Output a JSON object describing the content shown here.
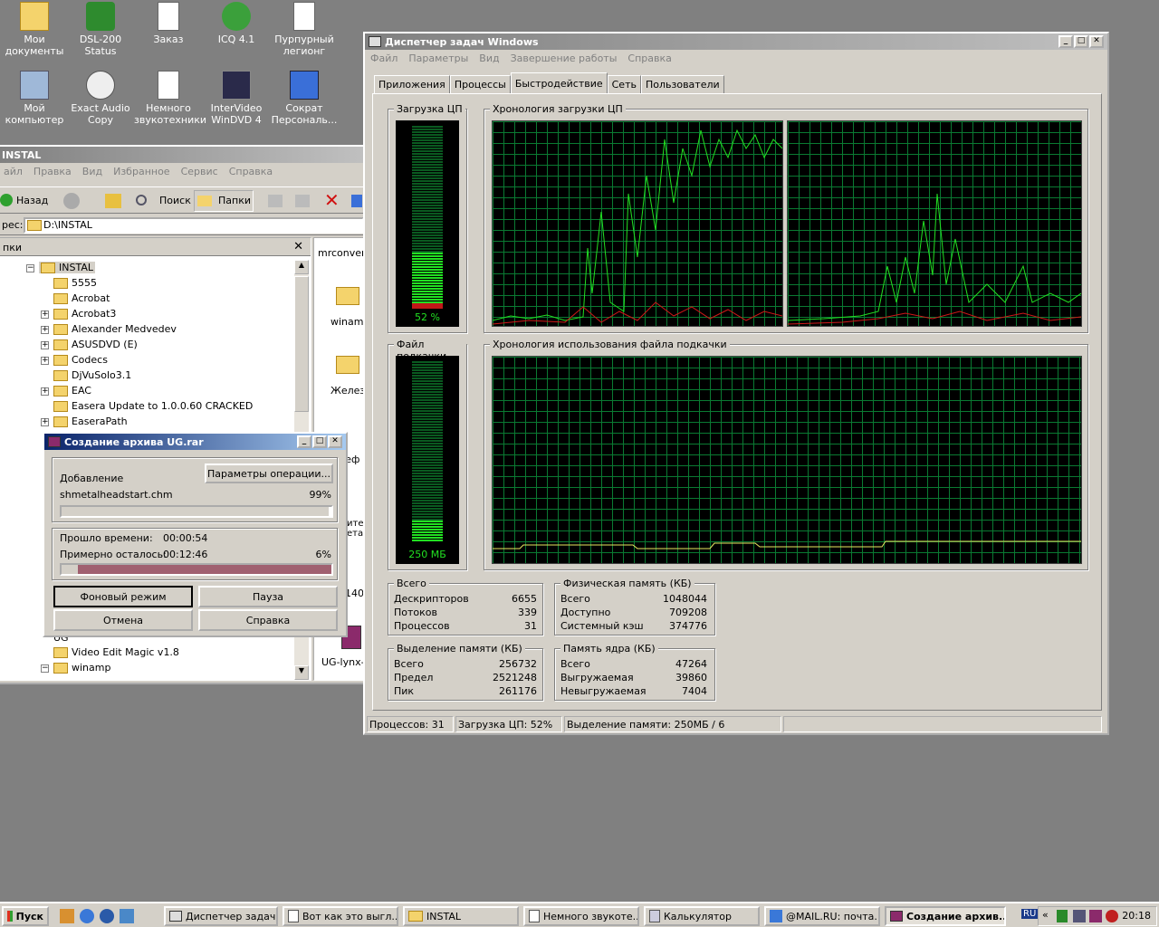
{
  "desktop": {
    "icons": [
      {
        "label": "Мои документы"
      },
      {
        "label": "DSL-200 Status"
      },
      {
        "label": "Заказ"
      },
      {
        "label": "ICQ 4.1"
      },
      {
        "label": "Пурпурный легионг"
      },
      {
        "label": "Мой компьютер"
      },
      {
        "label": "Exact Audio Copy"
      },
      {
        "label": "Немного звукотехники"
      },
      {
        "label": "InterVideo WinDVD 4"
      },
      {
        "label": "Сократ Персональ..."
      }
    ]
  },
  "explorer": {
    "title": "INSTAL",
    "menu": [
      "айл",
      "Правка",
      "Вид",
      "Избранное",
      "Сервис",
      "Справка"
    ],
    "toolbar": {
      "back": "Назад",
      "search": "Поиск",
      "folders": "Папки"
    },
    "address_label": "рес:",
    "address_value": "D:\\INSTAL",
    "folders_panel_title": "пки",
    "tree": [
      "INSTAL",
      "5555",
      "Acrobat",
      "Acrobat3",
      "Alexander Medvedev",
      "ASUSDVD (E)",
      "Codecs",
      "DjVuSolo3.1",
      "EAC",
      "Easera Update to 1.0.0.60 CRACKED",
      "EaseraPath",
      "UG",
      "Video Edit Magic v1.8",
      "winamp"
    ],
    "right_items": [
      "mrconvert",
      "winamp",
      "Желез",
      "Леф",
      "ите ета",
      "140",
      "UG-lynx-"
    ]
  },
  "rar_dialog": {
    "title": "Создание архива UG.rar",
    "adding_label": "Добавление",
    "params_button": "Параметры операции...",
    "filename": "shmetalheadstart.chm",
    "file_percent": "99%",
    "file_progress": 0.99,
    "elapsed_label": "Прошло времени:",
    "elapsed_value": "00:00:54",
    "remaining_label": "Примерно осталось:",
    "remaining_value": "00:12:46",
    "total_percent": "6%",
    "total_progress": 0.06,
    "buttons": {
      "background": "Фоновый режим",
      "pause": "Пауза",
      "cancel": "Отмена",
      "help": "Справка"
    }
  },
  "taskmgr": {
    "title": "Диспетчер задач Windows",
    "menu": [
      "Файл",
      "Параметры",
      "Вид",
      "Завершение работы",
      "Справка"
    ],
    "tabs": [
      "Приложения",
      "Процессы",
      "Быстродействие",
      "Сеть",
      "Пользователи"
    ],
    "active_tab": "Быстродействие",
    "cpu_usage_label": "Загрузка ЦП",
    "cpu_usage_value": "52 %",
    "cpu_level": 0.52,
    "cpu_history_label": "Хронология загрузки ЦП",
    "pagefile_label": "Файл подкачки",
    "pagefile_value": "250 МБ",
    "pagefile_level": 0.12,
    "pagefile_history_label": "Хронология использования файла подкачки",
    "totals": {
      "title": "Всего",
      "rows": [
        {
          "k": "Дескрипторов",
          "v": "6655"
        },
        {
          "k": "Потоков",
          "v": "339"
        },
        {
          "k": "Процессов",
          "v": "31"
        }
      ]
    },
    "physical": {
      "title": "Физическая память (КБ)",
      "rows": [
        {
          "k": "Всего",
          "v": "1048044"
        },
        {
          "k": "Доступно",
          "v": "709208"
        },
        {
          "k": "Системный кэш",
          "v": "374776"
        }
      ]
    },
    "commit": {
      "title": "Выделение памяти (КБ)",
      "rows": [
        {
          "k": "Всего",
          "v": "256732"
        },
        {
          "k": "Предел",
          "v": "2521248"
        },
        {
          "k": "Пик",
          "v": "261176"
        }
      ]
    },
    "kernel": {
      "title": "Память ядра (КБ)",
      "rows": [
        {
          "k": "Всего",
          "v": "47264"
        },
        {
          "k": "Выгружаемая",
          "v": "39860"
        },
        {
          "k": "Невыгружаемая",
          "v": "7404"
        }
      ]
    },
    "status": {
      "processes": "Процессов: 31",
      "cpu": "Загрузка ЦП: 52%",
      "memory": "Выделение памяти: 250МБ / 6"
    }
  },
  "taskbar": {
    "start": "Пуск",
    "items": [
      "Диспетчер задач...",
      "Вот как это выгл...",
      "INSTAL",
      "Немного звукоте...",
      "Калькулятор",
      "@MAIL.RU: почта...",
      "Создание архив..."
    ],
    "lang": "RU",
    "clock": "20:18"
  }
}
